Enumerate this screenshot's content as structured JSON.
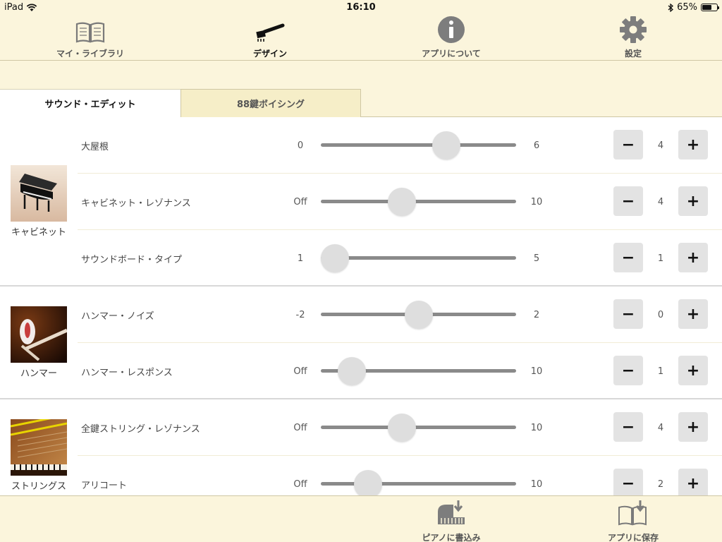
{
  "status_bar": {
    "device": "iPad",
    "time": "16:10",
    "battery": "65%",
    "battery_level": 0.65
  },
  "nav": [
    {
      "label": "マイ・ライブラリ",
      "icon": "book-icon",
      "active": false
    },
    {
      "label": "デザイン",
      "icon": "brush-icon",
      "active": true
    },
    {
      "label": "アプリについて",
      "icon": "info-icon",
      "active": false
    },
    {
      "label": "設定",
      "icon": "gear-icon",
      "active": false
    }
  ],
  "tabs": [
    {
      "label": "サウンド・エディット",
      "active": true
    },
    {
      "label": "88鍵ボイシング",
      "active": false
    }
  ],
  "groups": [
    {
      "label": "キャビネット",
      "icon": "grand-piano-image",
      "params": [
        {
          "name": "大屋根",
          "min": "0",
          "max": "6",
          "value": "4",
          "fraction": 0.6667
        },
        {
          "name": "キャビネット・レゾナンス",
          "min": "Off",
          "max": "10",
          "value": "4",
          "fraction": 0.4
        },
        {
          "name": "サウンドボード・タイプ",
          "min": "1",
          "max": "5",
          "value": "1",
          "fraction": 0.0
        }
      ]
    },
    {
      "label": "ハンマー",
      "icon": "hammer-image",
      "params": [
        {
          "name": "ハンマー・ノイズ",
          "min": "-2",
          "max": "2",
          "value": "0",
          "fraction": 0.5
        },
        {
          "name": "ハンマー・レスポンス",
          "min": "Off",
          "max": "10",
          "value": "1",
          "fraction": 0.1
        }
      ]
    },
    {
      "label": "ストリングス",
      "icon": "strings-image",
      "params": [
        {
          "name": "全鍵ストリング・レゾナンス",
          "min": "Off",
          "max": "10",
          "value": "4",
          "fraction": 0.4
        },
        {
          "name": "アリコート",
          "min": "Off",
          "max": "10",
          "value": "2",
          "fraction": 0.2
        }
      ]
    }
  ],
  "bottom": [
    {
      "label": "ピアノに書込み",
      "icon": "piano-download-icon"
    },
    {
      "label": "アプリに保存",
      "icon": "book-download-icon"
    }
  ]
}
